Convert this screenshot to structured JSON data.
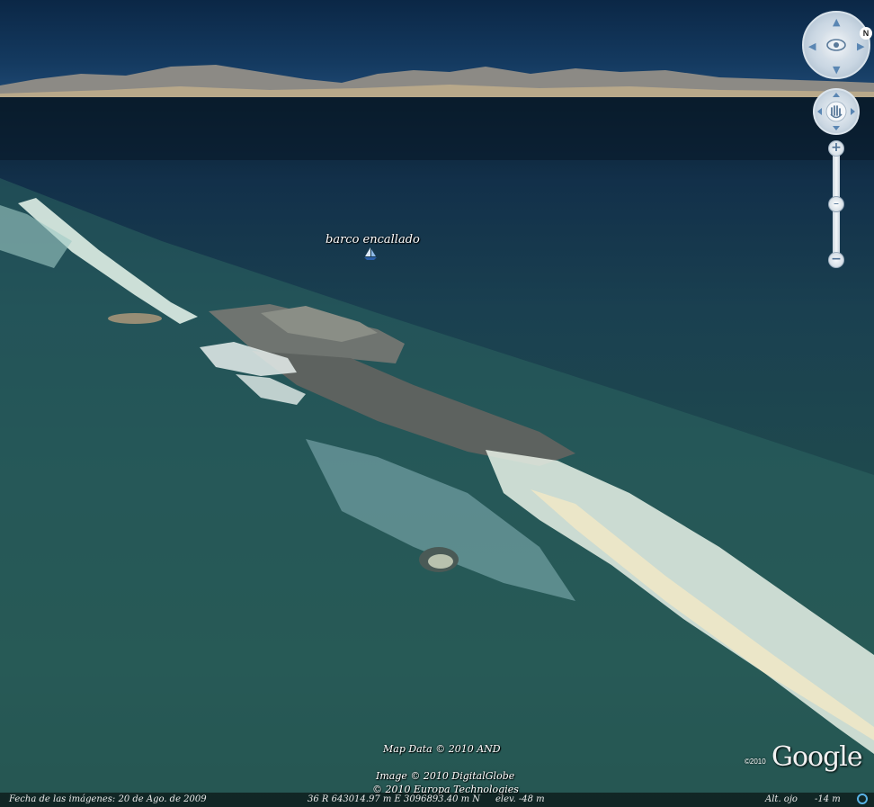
{
  "placemark": {
    "label": "barco encallado",
    "icon": "sailboat-icon"
  },
  "credits": {
    "map_data": "Map Data © 2010 AND",
    "image": "Image © 2010 DigitalGlobe",
    "europa": "© 2010 Europa Technologies"
  },
  "logo": {
    "text": "Google",
    "year": "©2010"
  },
  "status": {
    "imagery_date": "Fecha de las imágenes: 20 de Ago. de 2009",
    "coordinates": "36 R 643014.97 m E 3096893.40 m N",
    "elevation": "elev.  -48 m",
    "eye_alt_label": "Alt. ojo",
    "eye_alt_value": "-14 m"
  },
  "controls": {
    "north": "N",
    "zoom_in": "+",
    "zoom_out": "−",
    "icons": [
      "look-joystick-icon",
      "eye-icon",
      "move-joystick-icon",
      "hand-icon",
      "zoom-slider-icon",
      "streaming-indicator-icon"
    ]
  },
  "colors": {
    "sky": "#0b2746",
    "sea": "#1f4a4e",
    "surf": "#e8f0e6",
    "accent": "#5ab3e6"
  }
}
